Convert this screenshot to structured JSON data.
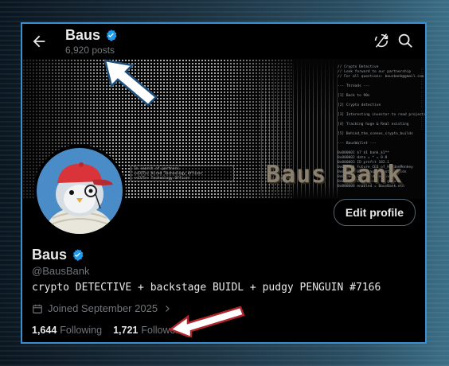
{
  "header": {
    "title": "Baus",
    "posts_count": "6,920 posts"
  },
  "banner": {
    "brand_text": "Baus Bank",
    "mini_box_lines": [
      "In search of partners",
      "<<CUT>> Hired Technology Officer",
      "<<CUT>> Technology Officer"
    ],
    "terminal_lines": [
      "// Crypto Detective",
      "// Look forward to our partnership",
      "// For all questions: bausbank@gmail.com",
      "",
      "--- Threads ---",
      "",
      "[1] Back to 90s",
      "",
      "[2] Crypto detective",
      "",
      "[3] Interesting investor to read projects",
      "",
      "[4] Tracking huge & Real existing",
      "",
      "[5] Behind_the_scenes_crypto_builds",
      "",
      "--- BausWallet ---",
      "",
      "0x000001 $7 $1 bank_$1**",
      "0x000002 data = * = 0.8",
      "0x000003 ID profit 182.1",
      "0x000004 Future_CEO_of_HiddenMonkey",
      "0x000005 Backstage_Crypto_Builds",
      "0x000006 Crypto detective",
      "0x000007 Let's time to grow",
      "0x000008 enabled = BausBank.eth"
    ]
  },
  "profile": {
    "name": "Baus",
    "handle": "@BausBank",
    "bio": "crypto DETECTIVE + backstage BUIDL + pudgy PENGUIN #7166",
    "joined": "Joined September 2025",
    "following_count": "1,644",
    "following_label": "Following",
    "followers_count": "1,721",
    "followers_label": "Followers",
    "edit_button": "Edit profile"
  },
  "colors": {
    "accent_verified": "#1d9bf0",
    "frame_border": "#3a8fd0",
    "avatar_bg": "#4a8cc8",
    "hat_red": "#d8343a"
  },
  "icons": [
    "back-arrow-icon",
    "verified-badge-icon",
    "refresh-icon",
    "search-icon",
    "calendar-icon",
    "chevron-right-icon"
  ]
}
